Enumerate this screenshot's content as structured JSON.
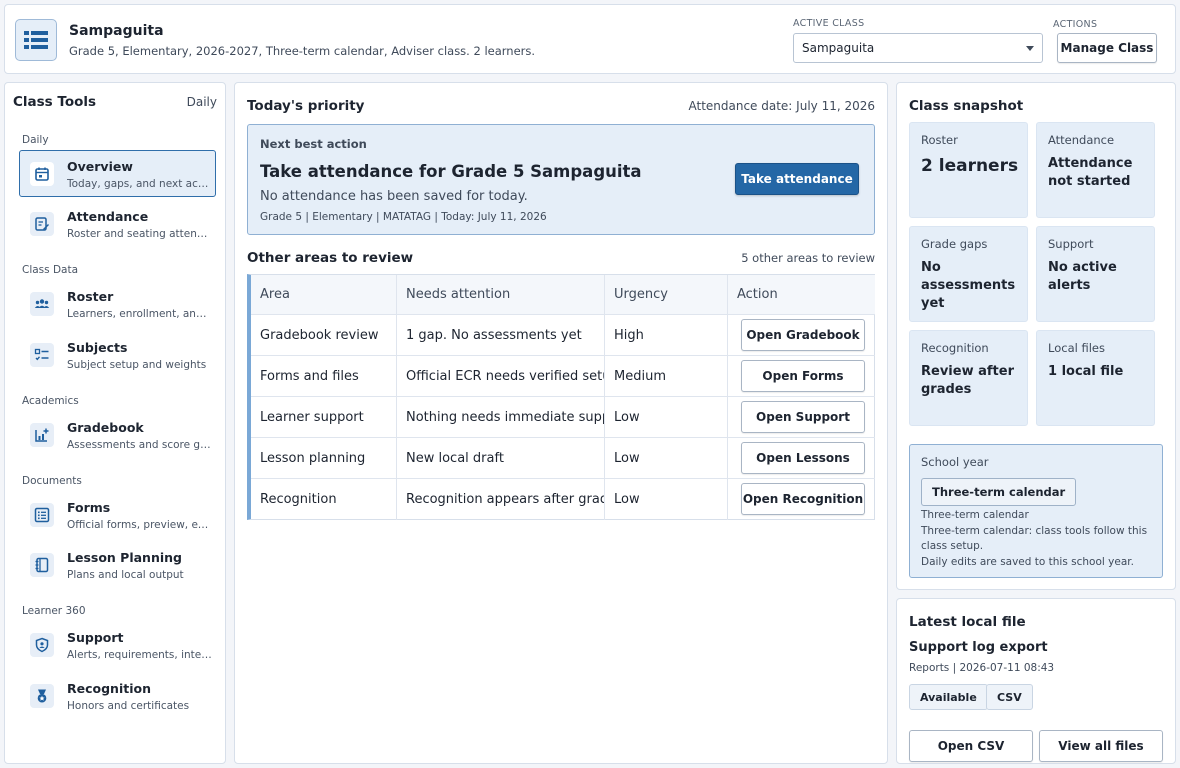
{
  "header": {
    "class_name": "Sampaguita",
    "class_desc": "Grade 5, Elementary, 2026-2027, Three-term calendar, Adviser class. 2 learners.",
    "active_class_label": "ACTIVE CLASS",
    "active_class_value": "Sampaguita",
    "actions_label": "ACTIONS",
    "manage_button": "Manage Class"
  },
  "sidebar": {
    "title": "Class Tools",
    "mode": "Daily",
    "groups": [
      "Daily",
      "Class Data",
      "Academics",
      "Documents",
      "Learner 360"
    ],
    "items": [
      {
        "name": "Overview",
        "desc": "Today, gaps, and next actions",
        "icon": "calendar-icon"
      },
      {
        "name": "Attendance",
        "desc": "Roster and seating attendance",
        "icon": "edit-checklist-icon"
      },
      {
        "name": "Roster",
        "desc": "Learners, enrollment, and imports",
        "icon": "people-icon"
      },
      {
        "name": "Subjects",
        "desc": "Subject setup and weights",
        "icon": "checklist-icon"
      },
      {
        "name": "Gradebook",
        "desc": "Assessments and score grid",
        "icon": "chart-plus-icon"
      },
      {
        "name": "Forms",
        "desc": "Official forms, preview, export",
        "icon": "form-icon"
      },
      {
        "name": "Lesson Planning",
        "desc": "Plans and local output",
        "icon": "notebook-icon"
      },
      {
        "name": "Support",
        "desc": "Alerts, requirements, interventions",
        "icon": "shield-icon"
      },
      {
        "name": "Recognition",
        "desc": "Honors and certificates",
        "icon": "medal-icon"
      }
    ]
  },
  "main": {
    "title": "Today's priority",
    "attendance_date": "Attendance date: July 11, 2026",
    "next_action": {
      "label": "Next best action",
      "title": "Take attendance for Grade 5 Sampaguita",
      "subtitle": "No attendance has been saved for today.",
      "meta": "Grade 5 | Elementary | MATATAG | Today: July 11, 2026",
      "button": "Take attendance"
    },
    "other_title": "Other areas to review",
    "other_count": "5 other areas to review",
    "columns": [
      "Area",
      "Needs attention",
      "Urgency",
      "Action"
    ],
    "rows": [
      {
        "area": "Gradebook review",
        "needs": "1 gap. No assessments yet",
        "urgency": "High",
        "action": "Open Gradebook"
      },
      {
        "area": "Forms and files",
        "needs": "Official ECR needs verified setup",
        "urgency": "Medium",
        "action": "Open Forms"
      },
      {
        "area": "Learner support",
        "needs": "Nothing needs immediate support",
        "urgency": "Low",
        "action": "Open Support"
      },
      {
        "area": "Lesson planning",
        "needs": "New local draft",
        "urgency": "Low",
        "action": "Open Lessons"
      },
      {
        "area": "Recognition",
        "needs": "Recognition appears after grades",
        "urgency": "Low",
        "action": "Open Recognition"
      }
    ]
  },
  "snapshot": {
    "title": "Class snapshot",
    "tiles": [
      {
        "label": "Roster",
        "value": "2 learners"
      },
      {
        "label": "Attendance",
        "value": "Attendance not started"
      },
      {
        "label": "Grade gaps",
        "value": "No assessments yet"
      },
      {
        "label": "Support",
        "value": "No active alerts"
      },
      {
        "label": "Recognition",
        "value": "Review after grades"
      },
      {
        "label": "Local files",
        "value": "1 local file"
      }
    ],
    "school_year": {
      "label": "School year",
      "chip": "Three-term calendar",
      "line1": "Three-term calendar",
      "line2": "Three-term calendar: class tools follow this class setup.",
      "line3": "Daily edits are saved to this school year."
    }
  },
  "latest": {
    "title": "Latest local file",
    "file_name": "Support log export",
    "meta": "Reports | 2026-07-11 08:43",
    "badge_status": "Available",
    "badge_type": "CSV",
    "open_button": "Open CSV",
    "view_all_button": "View all files"
  },
  "colors": {
    "accent": "#2467a6",
    "tile_bg": "#e5eef8",
    "border": "#d7dfea"
  }
}
